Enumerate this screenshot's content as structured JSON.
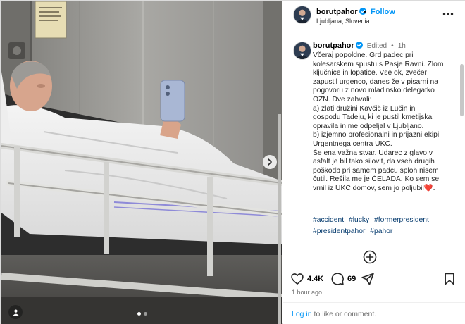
{
  "post": {
    "username": "borutpahor",
    "location": "Ljubljana, Slovenia",
    "follow_label": "Follow",
    "separator": "•",
    "edited_label": "Edited",
    "meta_dot": "•",
    "caption_time": "1h",
    "caption_lines": [
      "Včeraj popoldne. Grd padec pri",
      "kolesarskem spustu s Pasje Ravni. Zlom",
      "ključnice in lopatice. Vse ok, zvečer",
      "zapustil urgenco, danes že v pisarni na",
      "pogovoru z novo mladinsko delegatko",
      "OZN. Dve zahvali:",
      "a) zlati družini Kavčič iz Lučin in",
      "gospodu Tadeju, ki je pustil kmetijska",
      "opravila in me odpeljal v Ljubljano.",
      "b) izjemno profesionalni in prijazni ekipi",
      "Urgentnega centra UKC.",
      "Še ena važna stvar. Udarec z glavo v",
      "asfalt je bil tako silovit, da vseh drugih",
      "poškodb pri samem padcu sploh nisem",
      "čutil. Rešila me je ČELADA. Ko sem se"
    ],
    "caption_last_line": "vrnil iz UKC domov, sem jo poljubil",
    "caption_emoji": "❤️",
    "caption_end": ".",
    "hashtags": [
      "#accident",
      "#lucky",
      "#formerpresident",
      "#presidentpahor",
      "#pahor"
    ],
    "likes": "4.4K",
    "comments": "69",
    "time_ago": "1 hour ago",
    "login_prompt": "Log in",
    "comment_prompt": " to like or comment.",
    "carousel_total": 2,
    "carousel_current": 1
  },
  "icons": {
    "verified": "verified-badge-icon",
    "more": "more-options-icon",
    "next": "chevron-right-icon",
    "tag": "user-tag-icon",
    "load_more": "plus-circle-icon",
    "like": "heart-icon",
    "comment": "comment-icon",
    "share": "share-icon",
    "save": "bookmark-icon"
  },
  "colors": {
    "accent": "#0095f6",
    "hashtag": "#00376b",
    "muted": "#737373",
    "verified": "#0095f6"
  }
}
